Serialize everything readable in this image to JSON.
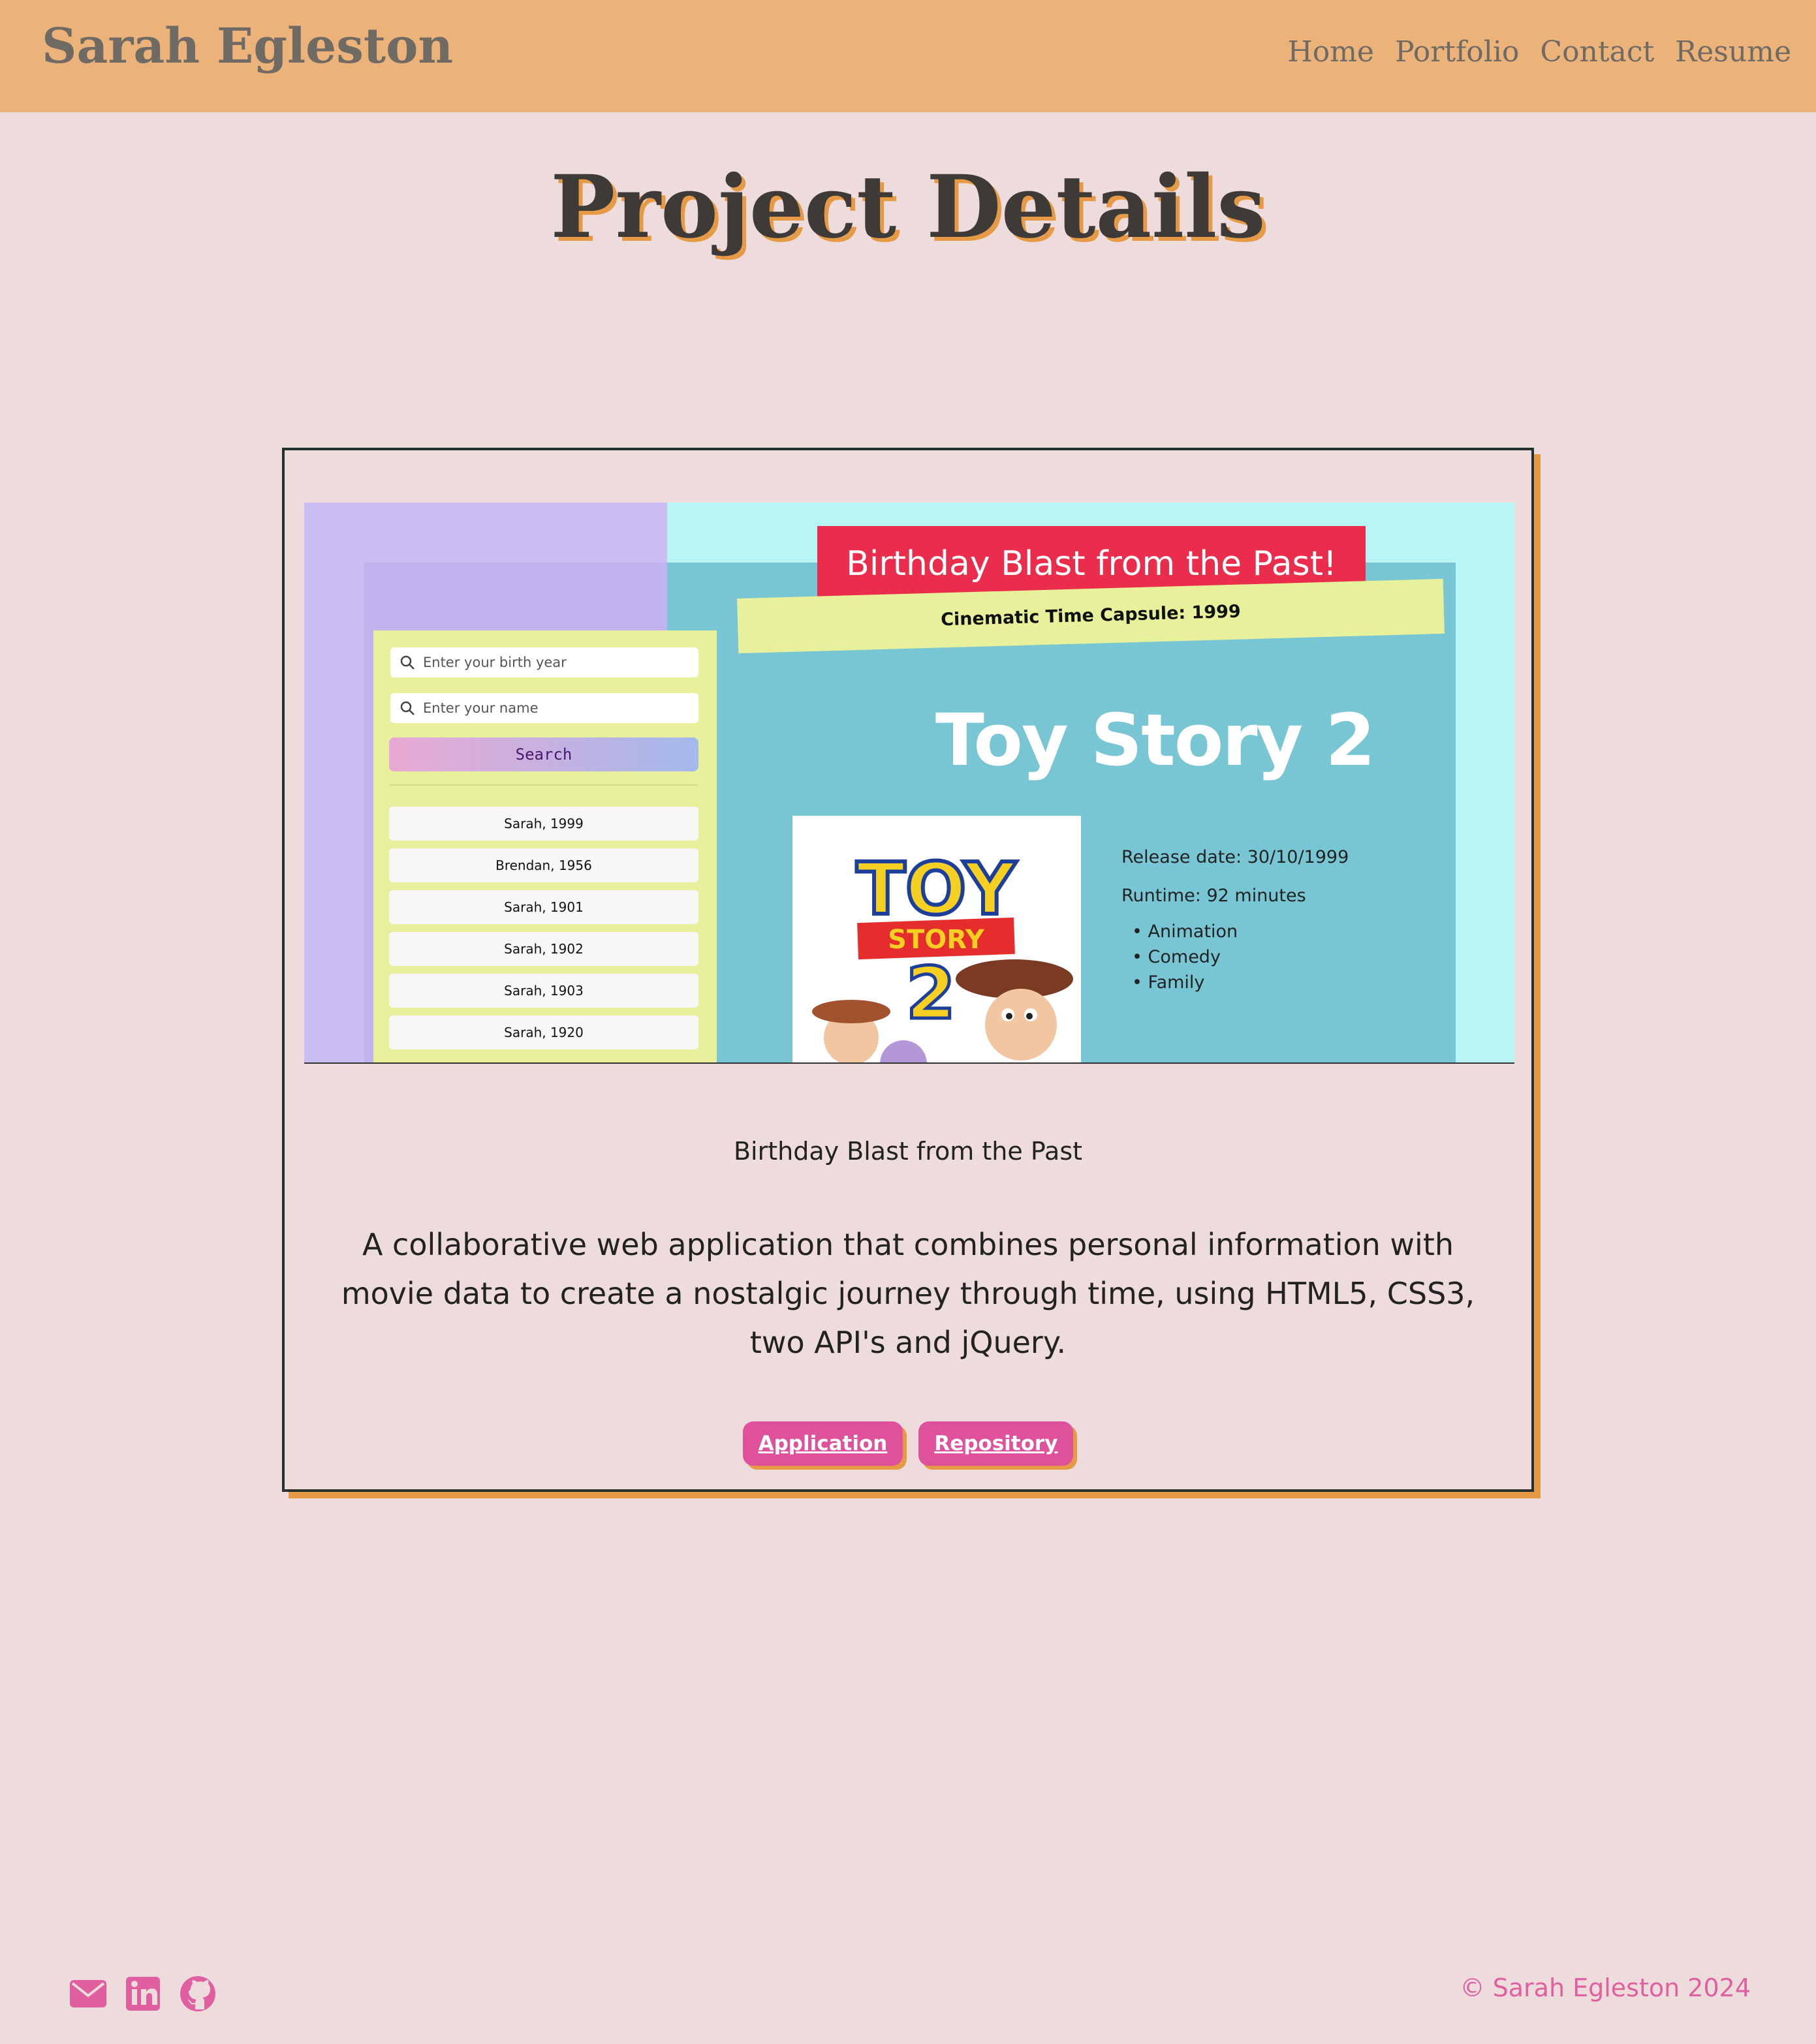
{
  "header": {
    "brand": "Sarah Egleston",
    "nav": [
      "Home",
      "Portfolio",
      "Contact",
      "Resume"
    ]
  },
  "page_title": "Project Details",
  "screenshot": {
    "banner": "Birthday Blast from the Past!",
    "subbanner": "Cinematic Time Capsule: 1999",
    "year_placeholder": "Enter your birth year",
    "name_placeholder": "Enter your name",
    "search_label": "Search",
    "history": [
      "Sarah, 1999",
      "Brendan, 1956",
      "Sarah, 1901",
      "Sarah, 1902",
      "Sarah, 1903",
      "Sarah, 1920"
    ],
    "movie_title": "Toy Story 2",
    "release_date": "Release date: 30/10/1999",
    "runtime": "Runtime: 92 minutes",
    "genres": [
      "Animation",
      "Comedy",
      "Family"
    ],
    "poster_line1": "TOY",
    "poster_line2": "STORY",
    "poster_line3": "2"
  },
  "project": {
    "name": "Birthday Blast from the Past",
    "description": "A collaborative web application that combines personal information with movie data to create a nostalgic journey through time, using HTML5, CSS3, two API's and jQuery.",
    "buttons": [
      "Application",
      "Repository"
    ]
  },
  "footer": {
    "icons": [
      "envelope-icon",
      "linkedin-icon",
      "github-icon"
    ],
    "copyright": "© Sarah Egleston 2024"
  },
  "colors": {
    "header_bg": "#ebb27a",
    "page_bg": "#eedcdc",
    "accent_pink": "#df519b",
    "accent_orange": "#e69a45"
  }
}
